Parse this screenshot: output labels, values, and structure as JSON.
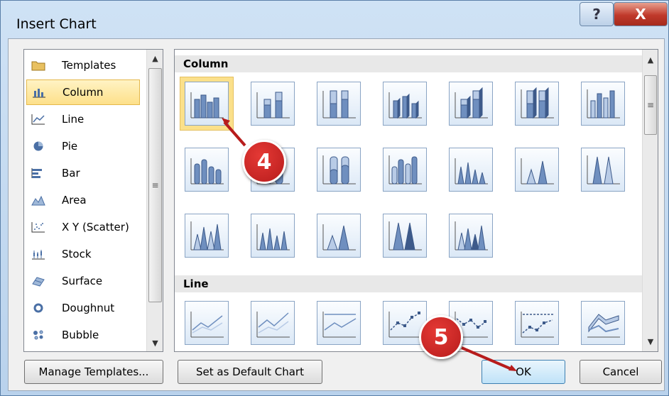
{
  "window": {
    "title": "Insert Chart",
    "help_label": "?",
    "close_label": "X"
  },
  "categories": [
    {
      "label": "Templates",
      "icon": "folder-icon"
    },
    {
      "label": "Column",
      "icon": "column-chart-icon",
      "selected": true
    },
    {
      "label": "Line",
      "icon": "line-chart-icon"
    },
    {
      "label": "Pie",
      "icon": "pie-chart-icon"
    },
    {
      "label": "Bar",
      "icon": "bar-chart-icon"
    },
    {
      "label": "Area",
      "icon": "area-chart-icon"
    },
    {
      "label": "X Y (Scatter)",
      "icon": "scatter-chart-icon"
    },
    {
      "label": "Stock",
      "icon": "stock-chart-icon"
    },
    {
      "label": "Surface",
      "icon": "surface-chart-icon"
    },
    {
      "label": "Doughnut",
      "icon": "doughnut-chart-icon"
    },
    {
      "label": "Bubble",
      "icon": "bubble-chart-icon"
    }
  ],
  "gallery": {
    "sections": [
      {
        "title": "Column"
      },
      {
        "title": "Line"
      }
    ]
  },
  "buttons": {
    "manage_templates": "Manage Templates...",
    "set_default": "Set as Default Chart",
    "ok": "OK",
    "cancel": "Cancel"
  },
  "callouts": {
    "first": "4",
    "second": "5"
  },
  "colors": {
    "accent": "#4a6fa5",
    "selection": "#fde08a",
    "callout": "#c62828"
  }
}
